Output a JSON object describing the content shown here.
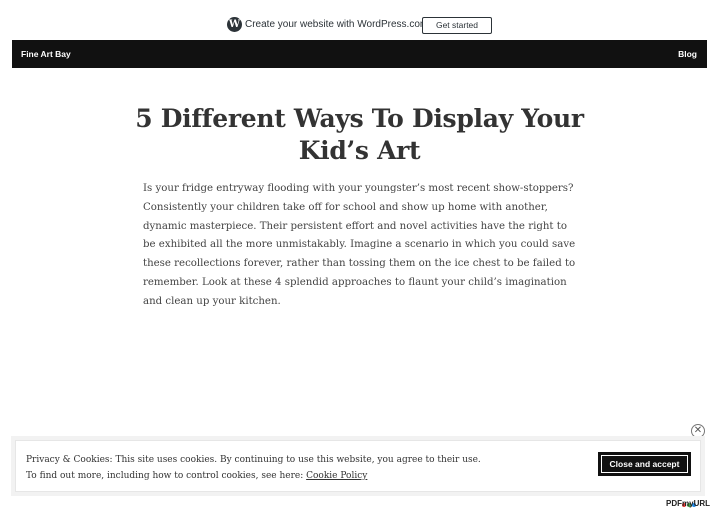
{
  "wp_bar": {
    "icon": "wordpress-logo-icon",
    "text": "Create your website with WordPress.com",
    "button_label": "Get started"
  },
  "header": {
    "site_title": "Fine Art Bay",
    "nav": [
      {
        "label": "Blog"
      }
    ]
  },
  "post": {
    "title": "5 Different Ways To Display Your Kid’s Art",
    "body": "Is your fridge entryway flooding with your youngster’s most recent show-stoppers? Consistently your children take off for school and show up home with another, dynamic masterpiece. Their persistent effort and novel activities have the right to be exhibited all the more unmistakably. Imagine a scenario in which you could save these recollections forever, rather than tossing them on the ice chest to be failed to remember. Look at these 4 splendid approaches to flaunt your child’s imagination and clean up your kitchen."
  },
  "cookie_banner": {
    "line1": "Privacy & Cookies: This site uses cookies. By continuing to use this website, you agree to their use.",
    "line2_prefix": "To find out more, including how to control cookies, see here: ",
    "link_label": "Cookie Policy",
    "accept_label": "Close and accept",
    "close_icon": "close-icon"
  },
  "badge": {
    "text": "PDFmyURL",
    "colors": [
      "#e53935",
      "#43a047",
      "#1e88e5"
    ]
  }
}
